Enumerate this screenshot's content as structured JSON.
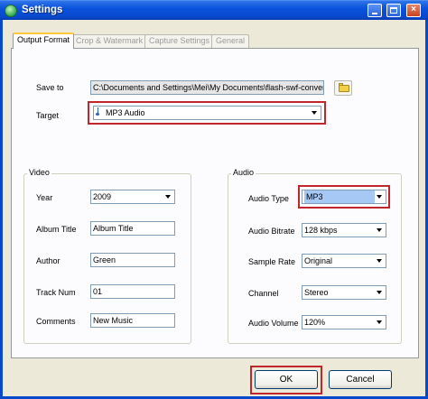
{
  "window": {
    "title": "Settings"
  },
  "tabs": [
    "Output Format",
    "Crop & Watermark",
    "Capture Settings",
    "General"
  ],
  "output": {
    "save_to_label": "Save to",
    "save_to_value": "C:\\Documents and Settings\\Mei\\My Documents\\flash-swf-convert",
    "target_label": "Target",
    "target_value": "MP3 Audio"
  },
  "video": {
    "title": "Video",
    "year_label": "Year",
    "year_value": "2009",
    "album_title_label": "Album Title",
    "album_title_value": "Album Title",
    "author_label": "Author",
    "author_value": "Green",
    "track_num_label": "Track Num",
    "track_num_value": "01",
    "comments_label": "Comments",
    "comments_value": "New Music"
  },
  "audio": {
    "title": "Audio",
    "audio_type_label": "Audio Type",
    "audio_type_value": "MP3",
    "audio_bitrate_label": "Audio Bitrate",
    "audio_bitrate_value": "128 kbps",
    "sample_rate_label": "Sample Rate",
    "sample_rate_value": "Original",
    "channel_label": "Channel",
    "channel_value": "Stereo",
    "audio_volume_label": "Audio Volume",
    "audio_volume_value": "120%"
  },
  "buttons": {
    "ok": "OK",
    "cancel": "Cancel"
  },
  "colors": {
    "highlight": "#c0262b",
    "titlebar": "#0a52dc",
    "active_tab_accent": "#ffc73c"
  }
}
